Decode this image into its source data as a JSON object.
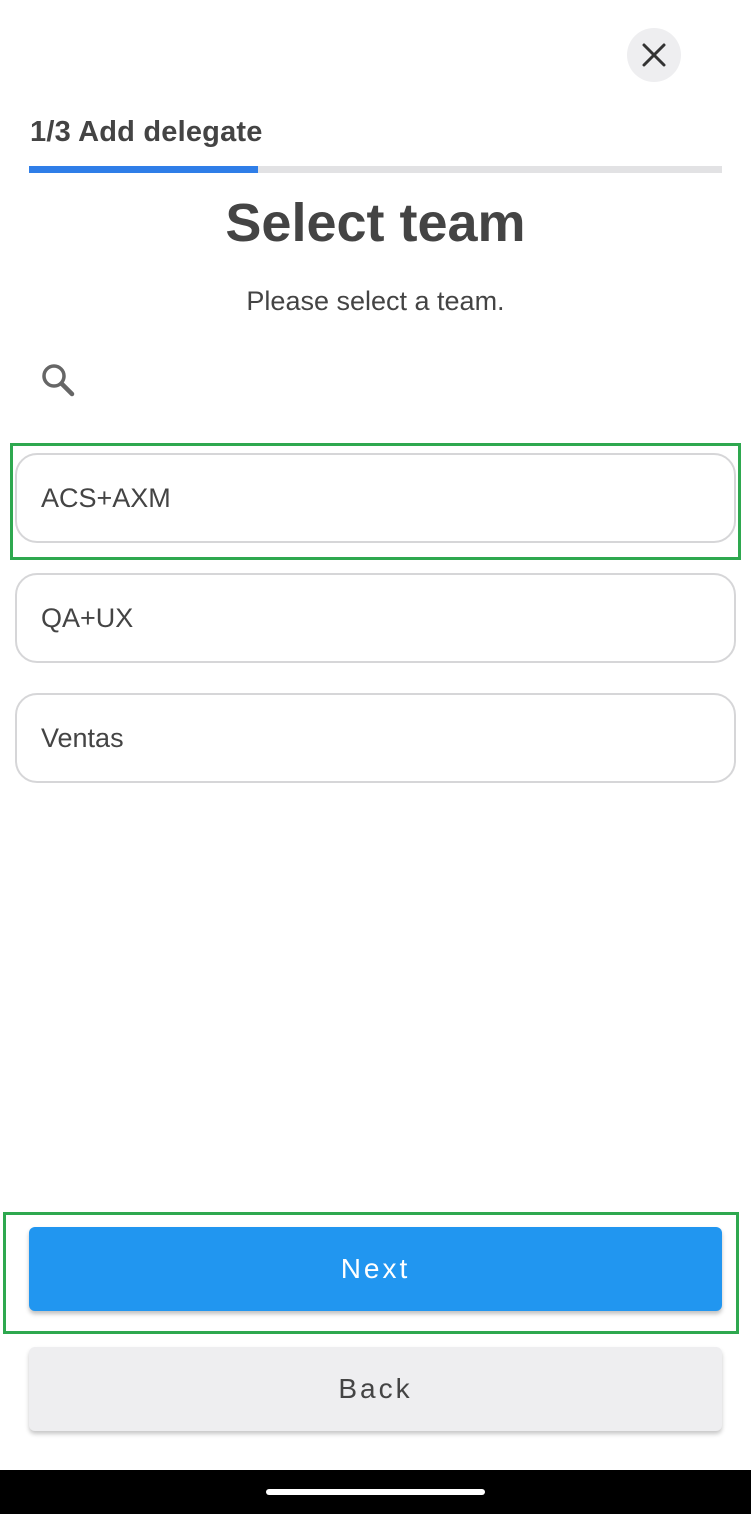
{
  "header": {
    "close_icon": "close-icon",
    "step_title": "1/3 Add delegate",
    "progress_fraction": 0.33,
    "progress_color": "#2f7ee8"
  },
  "main": {
    "title": "Select team",
    "subtitle": "Please select a team.",
    "search_icon": "search-icon",
    "teams": [
      {
        "label": "ACS+AXM"
      },
      {
        "label": "QA+UX"
      },
      {
        "label": "Ventas"
      }
    ]
  },
  "footer": {
    "next_label": "Next",
    "back_label": "Back",
    "next_color": "#2196f0"
  }
}
